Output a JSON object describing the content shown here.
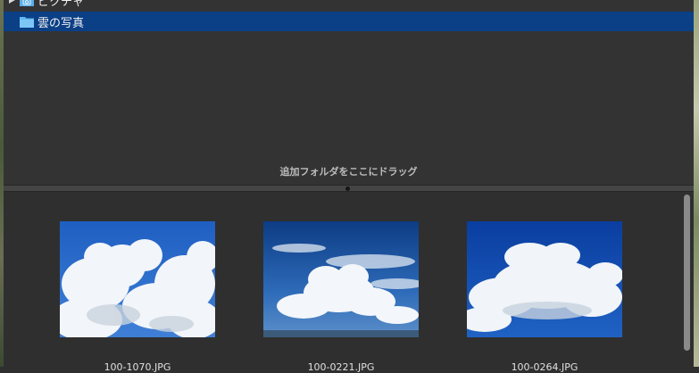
{
  "folder_tree": {
    "items": [
      {
        "label": "ピクチャ",
        "selected": false,
        "expandable": true,
        "icon": "pictures-folder-icon"
      },
      {
        "label": "雲の写真",
        "selected": true,
        "expandable": false,
        "icon": "folder-icon"
      }
    ],
    "drop_hint": "追加フォルダをここにドラッグ"
  },
  "thumbnails": [
    {
      "filename": "100-1070.JPG",
      "scene": "cumulus-clouds"
    },
    {
      "filename": "100-0221.JPG",
      "scene": "clouds-over-horizon"
    },
    {
      "filename": "100-0264.JPG",
      "scene": "towering-cumulus"
    }
  ],
  "colors": {
    "panel_bg": "#333333",
    "selection": "#0b3f86",
    "folder_blue": "#62b7f0"
  }
}
